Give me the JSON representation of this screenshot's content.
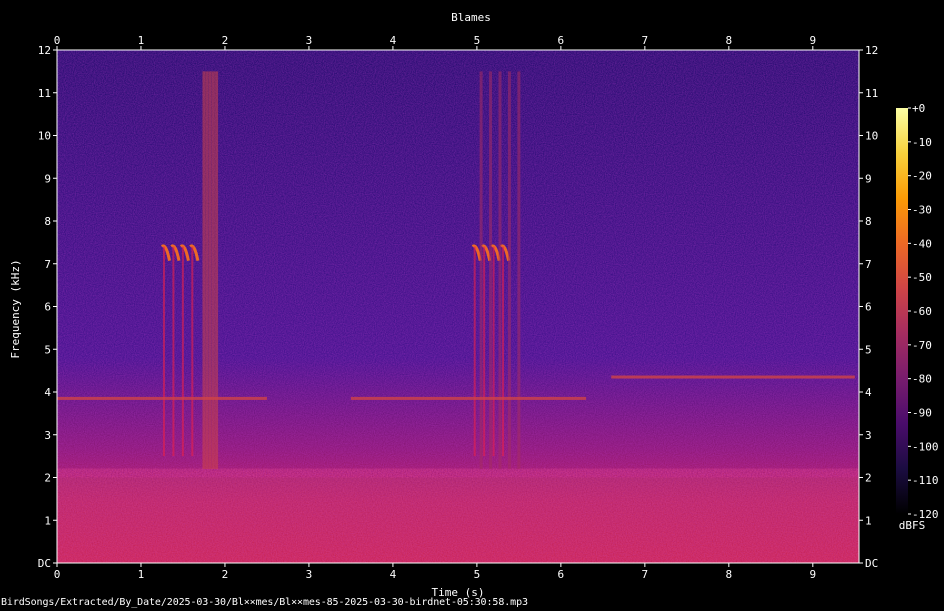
{
  "chart_data": {
    "type": "heatmap",
    "title": "Blames",
    "xlabel": "Time (s)",
    "ylabel": "Frequency (kHz)",
    "xlim": [
      0,
      9.55
    ],
    "ylim": [
      0,
      12
    ],
    "x_ticks": [
      "0",
      "1",
      "2",
      "3",
      "4",
      "5",
      "6",
      "7",
      "8",
      "9"
    ],
    "y_ticks": [
      "DC",
      "1",
      "2",
      "3",
      "4",
      "5",
      "6",
      "7",
      "8",
      "9",
      "10",
      "11",
      "12"
    ],
    "colorbar": {
      "label": "dBFS",
      "range": [
        -120,
        0
      ],
      "ticks": [
        "+0",
        "-10",
        "-20",
        "-30",
        "-40",
        "-50",
        "-60",
        "-70",
        "-80",
        "-90",
        "-100",
        "-110",
        "-120"
      ],
      "colors": [
        "#000000",
        "#1b0c41",
        "#4a0c6b",
        "#781c6d",
        "#a52c60",
        "#cf4446",
        "#ed6925",
        "#fb9b06",
        "#f7d13d",
        "#fcffa4"
      ]
    },
    "features": [
      {
        "label": "trill",
        "t_start": 1.25,
        "t_end": 1.7,
        "f_khz": 7.4,
        "level_db": -35
      },
      {
        "label": "trill",
        "t_start": 4.95,
        "t_end": 5.4,
        "f_khz": 7.4,
        "level_db": -35
      },
      {
        "label": "vertical clicks",
        "t_start": 1.75,
        "t_end": 1.9,
        "f_khz": [
          2.2,
          11.5
        ],
        "level_db": -60
      },
      {
        "label": "vertical clicks",
        "t_start": 5.05,
        "t_end": 5.5,
        "f_khz": [
          2.2,
          11.5
        ],
        "level_db": -62
      },
      {
        "label": "tone band",
        "t_start": 0.0,
        "t_end": 2.5,
        "f_khz": 3.85,
        "level_db": -55
      },
      {
        "label": "tone band",
        "t_start": 3.5,
        "t_end": 6.3,
        "f_khz": 3.85,
        "level_db": -55
      },
      {
        "label": "tone band",
        "t_start": 6.6,
        "t_end": 9.5,
        "f_khz": 4.35,
        "level_db": -58
      },
      {
        "label": "low-frequency noise",
        "t_start": 0.0,
        "t_end": 9.55,
        "f_khz": [
          0,
          2.0
        ],
        "level_db": -65
      }
    ]
  },
  "caption": "BirdSongs/Extracted/By_Date/2025-03-30/Bl××mes/Bl××mes-85-2025-03-30-birdnet-05:30:58.mp3"
}
